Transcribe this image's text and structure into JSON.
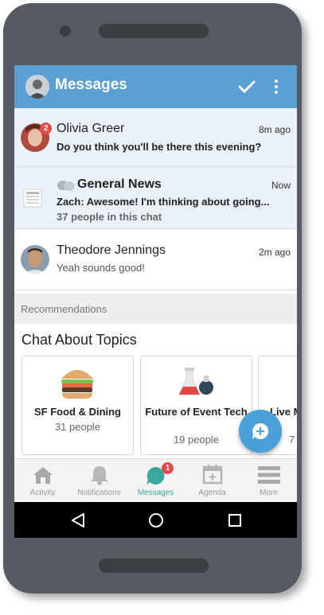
{
  "header": {
    "title": "Messages"
  },
  "messages": [
    {
      "name": "Olivia Greer",
      "time": "8m ago",
      "preview": "Do you think you'll be there this evening?",
      "badge": "2"
    },
    {
      "name": "General News",
      "time": "Now",
      "preview": "Zach: Awesome! I'm thinking about going...",
      "meta": "37 people in this chat"
    },
    {
      "name": "Theodore Jennings",
      "time": "2m ago",
      "preview": "Yeah sounds good!"
    }
  ],
  "recommendations": {
    "section_label": "Recommendations",
    "title": "Chat About Topics",
    "cards": [
      {
        "label": "SF Food & Dining",
        "count": "31 people",
        "icon": "burger-icon"
      },
      {
        "label": "Future of Event Tech",
        "count": "19 people",
        "icon": "flask-icon"
      },
      {
        "label": "Live M",
        "count": "7",
        "icon": "none"
      }
    ]
  },
  "bottom_nav": {
    "items": [
      {
        "label": "Activity",
        "icon": "home-icon"
      },
      {
        "label": "Notifications",
        "icon": "bell-icon"
      },
      {
        "label": "Messages",
        "icon": "chat-icon",
        "badge": "1",
        "active": true
      },
      {
        "label": "Agenda",
        "icon": "calendar-icon"
      },
      {
        "label": "More",
        "icon": "menu-icon"
      }
    ]
  },
  "colors": {
    "header": "#5aa0d4",
    "accent": "#39a9a0",
    "badge": "#e64b4b",
    "fab": "#4aa0d9"
  }
}
